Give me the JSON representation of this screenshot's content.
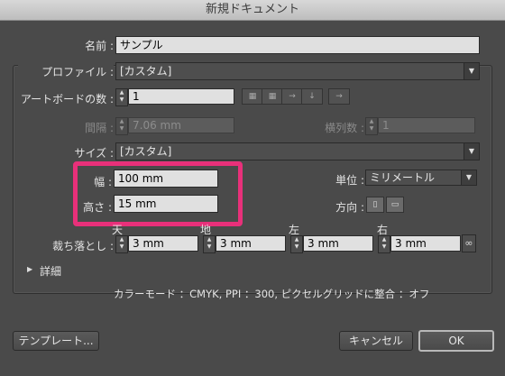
{
  "window": {
    "title": "新規ドキュメント"
  },
  "name": {
    "label": "名前 :",
    "value": "サンプル"
  },
  "profile": {
    "label": "プロファイル :",
    "value": "[カスタム]"
  },
  "artboards": {
    "label": "アートボードの数 :",
    "value": "1"
  },
  "spacing": {
    "label": "間隔 :",
    "value": "7.06 mm"
  },
  "columns": {
    "label": "横列数 :",
    "value": "1"
  },
  "size": {
    "label": "サイズ :",
    "value": "[カスタム]"
  },
  "width": {
    "label": "幅 :",
    "value": "100 mm"
  },
  "height": {
    "label": "高さ :",
    "value": "15 mm"
  },
  "units": {
    "label": "単位 :",
    "value": "ミリメートル"
  },
  "orientation": {
    "label": "方向 :"
  },
  "bleed": {
    "label": "裁ち落とし :",
    "top_label": "天",
    "top_value": "3 mm",
    "bottom_label": "地",
    "bottom_value": "3 mm",
    "left_label": "左",
    "left_value": "3 mm",
    "right_label": "右",
    "right_value": "3 mm"
  },
  "advanced": {
    "label": "詳細"
  },
  "info": "カラーモード ：CMYK, PPI ：300, ピクセルグリッドに整合 ：オフ",
  "buttons": {
    "templates": "テンプレート...",
    "cancel": "キャンセル",
    "ok": "OK"
  },
  "accent_color": "#e8307a",
  "icons": [
    "grid-by-row-icon",
    "grid-by-column-icon",
    "arrange-by-row-icon",
    "arrange-by-column-icon",
    "right-to-left-icon",
    "portrait-icon",
    "landscape-icon",
    "chain-link-icon",
    "disclosure-triangle-icon"
  ]
}
